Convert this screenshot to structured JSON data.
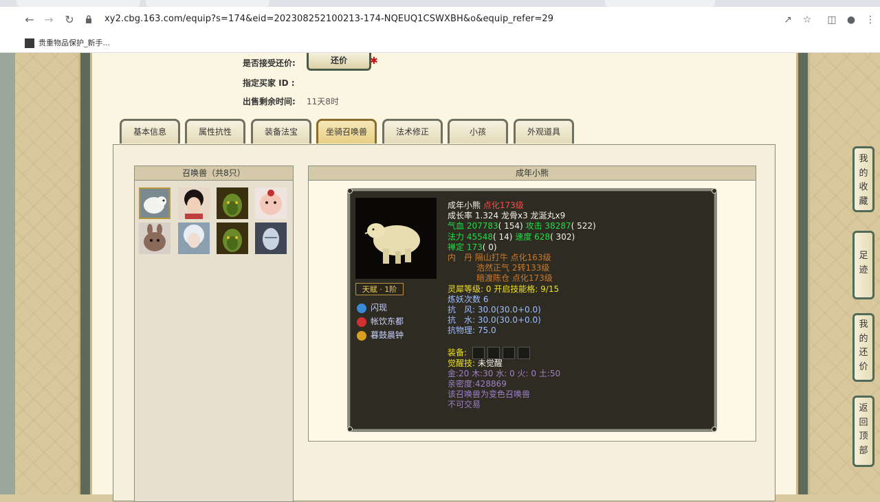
{
  "browser": {
    "url": "xy2.cbg.163.com/equip?s=174&eid=202308252100213-174-NQEUQ1CSWXBH&o&equip_refer=29",
    "bookmark_label": "贵重物品保护_新手..."
  },
  "sale_info": {
    "accept_bargain_label": "是否接受还价:",
    "bargain_button": "还价",
    "buyer_id_label": "指定买家 ID :",
    "time_left_label": "出售剩余时间:",
    "time_left_value": "11天8时"
  },
  "tabs": [
    {
      "label": "基本信息"
    },
    {
      "label": "属性抗性"
    },
    {
      "label": "装备法宝"
    },
    {
      "label": "坐骑召唤兽",
      "active": true
    },
    {
      "label": "法术修正"
    },
    {
      "label": "小孩"
    },
    {
      "label": "外观道具"
    }
  ],
  "pet_list": {
    "title": "召唤兽（共8只）"
  },
  "detail": {
    "title": "成年小熊",
    "name": "成年小熊",
    "enhance": "点化173级",
    "growth_line": "成长率 1.324 龙骨x3 龙涎丸x9",
    "hp_label": "气血",
    "hp_value": "207783",
    "hp_points": "( 154)",
    "atk_label": "攻击",
    "atk_value": "38287",
    "atk_points": "( 522)",
    "mp_label": "法力",
    "mp_value": "45548",
    "mp_points": "( 14)",
    "spd_label": "速度",
    "spd_value": "628",
    "spd_points": "( 302)",
    "focus_label": "禅定",
    "focus_value": "173",
    "focus_points": "( 0)",
    "inner_label": "内　丹",
    "inner_1": "隔山打牛 点化163级",
    "inner_2": "浩然正气 2转133级",
    "inner_3": "暗渡陈仓 点化173级",
    "spirit_line": "灵犀等级:  0 开启技能格:  9/15",
    "refine_line": "炼妖次数 6",
    "resist_wind": "抗　风: 30.0(30.0+0.0)",
    "resist_water": "抗　水: 30.0(30.0+0.0)",
    "resist_phys": "抗物理: 75.0",
    "equip_label": "装备:",
    "awaken_label": "觉醒技:",
    "awaken_value": "未觉醒",
    "elements": "金:20 木:30 水: 0 火: 0 土:50",
    "intimacy": "亲密度:428869",
    "variant_note": "该召唤兽为变色召唤兽",
    "tradable": "不可交易",
    "talent": "天赋 · 1阶",
    "skills": [
      {
        "name": "闪现",
        "color": "#3a8ad8"
      },
      {
        "name": "帐饮东都",
        "color": "#d03030"
      },
      {
        "name": "暮鼓晨钟",
        "color": "#d8a020"
      }
    ]
  },
  "side_buttons": [
    {
      "label": "我的收藏"
    },
    {
      "label": "足迹"
    },
    {
      "label": "我的还价"
    },
    {
      "label": "返回顶部"
    }
  ]
}
